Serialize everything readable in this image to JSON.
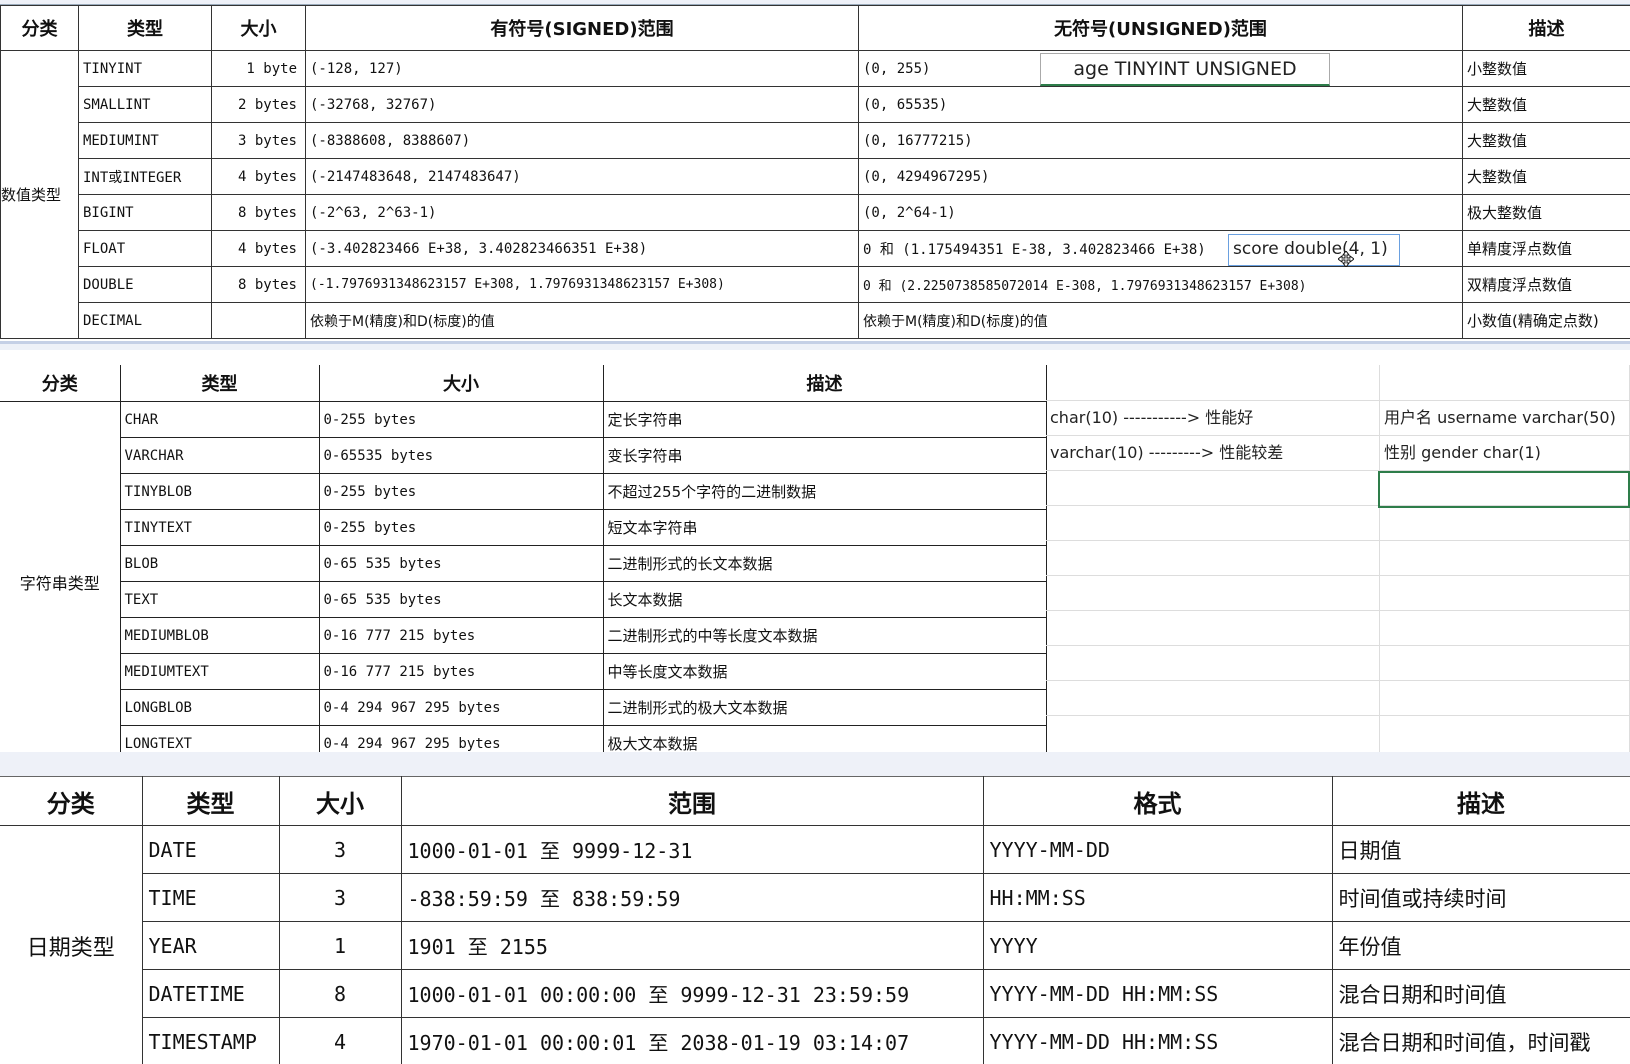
{
  "numeric": {
    "headers": [
      "分类",
      "类型",
      "大小",
      "有符号(SIGNED)范围",
      "无符号(UNSIGNED)范围",
      "描述"
    ],
    "category": "数值类型",
    "rows": [
      {
        "type": "TINYINT",
        "size": "1 byte",
        "signed": "(-128, 127)",
        "unsigned": "(0, 255)",
        "desc": "小整数值"
      },
      {
        "type": "SMALLINT",
        "size": "2 bytes",
        "signed": "(-32768, 32767)",
        "unsigned": "(0, 65535)",
        "desc": "大整数值"
      },
      {
        "type": "MEDIUMINT",
        "size": "3 bytes",
        "signed": "(-8388608, 8388607)",
        "unsigned": "(0, 16777215)",
        "desc": "大整数值"
      },
      {
        "type": "INT或INTEGER",
        "size": "4 bytes",
        "signed": "(-2147483648, 2147483647)",
        "unsigned": "(0, 4294967295)",
        "desc": "大整数值"
      },
      {
        "type": "BIGINT",
        "size": "8 bytes",
        "signed": "(-2^63, 2^63-1)",
        "unsigned": "(0, 2^64-1)",
        "desc": "极大整数值"
      },
      {
        "type": "FLOAT",
        "size": "4 bytes",
        "signed": "(-3.402823466 E+38, 3.402823466351 E+38)",
        "unsigned": "0 和 (1.175494351 E-38, 3.402823466 E+38)",
        "desc": "单精度浮点数值"
      },
      {
        "type": "DOUBLE",
        "size": "8 bytes",
        "signed": "(-1.7976931348623157 E+308, 1.7976931348623157 E+308)",
        "unsigned": "0 和 (2.2250738585072014 E-308, 1.7976931348623157 E+308)",
        "desc": "双精度浮点数值"
      },
      {
        "type": "DECIMAL",
        "size": "",
        "signed": "依赖于M(精度)和D(标度)的值",
        "unsigned": "依赖于M(精度)和D(标度)的值",
        "desc": "小数值(精确定点数)"
      }
    ],
    "notes": {
      "age": "age TINYINT UNSIGNED",
      "score": "score double(4, 1)"
    }
  },
  "string": {
    "headers": [
      "分类",
      "类型",
      "大小",
      "描述"
    ],
    "category": "字符串类型",
    "rows": [
      {
        "type": "CHAR",
        "size": "0-255 bytes",
        "desc": "定长字符串"
      },
      {
        "type": "VARCHAR",
        "size": "0-65535 bytes",
        "desc": "变长字符串"
      },
      {
        "type": "TINYBLOB",
        "size": "0-255 bytes",
        "desc": "不超过255个字符的二进制数据"
      },
      {
        "type": "TINYTEXT",
        "size": "0-255 bytes",
        "desc": "短文本字符串"
      },
      {
        "type": "BLOB",
        "size": "0-65 535 bytes",
        "desc": "二进制形式的长文本数据"
      },
      {
        "type": "TEXT",
        "size": "0-65 535 bytes",
        "desc": "长文本数据"
      },
      {
        "type": "MEDIUMBLOB",
        "size": "0-16 777 215 bytes",
        "desc": "二进制形式的中等长度文本数据"
      },
      {
        "type": "MEDIUMTEXT",
        "size": "0-16 777 215 bytes",
        "desc": "中等长度文本数据"
      },
      {
        "type": "LONGBLOB",
        "size": "0-4 294 967 295 bytes",
        "desc": "二进制形式的极大文本数据"
      },
      {
        "type": "LONGTEXT",
        "size": "0-4 294 967 295 bytes",
        "desc": "极大文本数据"
      }
    ],
    "notes": {
      "char_perf": "char(10) -----------> 性能好",
      "varchar_perf": "varchar(10) ---------> 性能较差",
      "username": "用户名 username varchar(50)",
      "gender": "性别 gender char(1)"
    }
  },
  "date": {
    "headers": [
      "分类",
      "类型",
      "大小",
      "范围",
      "格式",
      "描述"
    ],
    "category": "日期类型",
    "rows": [
      {
        "type": "DATE",
        "size": "3",
        "range": "1000-01-01 至 9999-12-31",
        "format": "YYYY-MM-DD",
        "desc": "日期值"
      },
      {
        "type": "TIME",
        "size": "3",
        "range": "-838:59:59 至 838:59:59",
        "format": "HH:MM:SS",
        "desc": "时间值或持续时间"
      },
      {
        "type": "YEAR",
        "size": "1",
        "range": "1901 至 2155",
        "format": "YYYY",
        "desc": "年份值"
      },
      {
        "type": "DATETIME",
        "size": "8",
        "range": "1000-01-01 00:00:00 至 9999-12-31 23:59:59",
        "format": "YYYY-MM-DD HH:MM:SS",
        "desc": "混合日期和时间值"
      },
      {
        "type": "TIMESTAMP",
        "size": "4",
        "range": "1970-01-01 00:00:01 至 2038-01-19 03:14:07",
        "format": "YYYY-MM-DD HH:MM:SS",
        "desc": "混合日期和时间值，时间戳"
      }
    ]
  }
}
